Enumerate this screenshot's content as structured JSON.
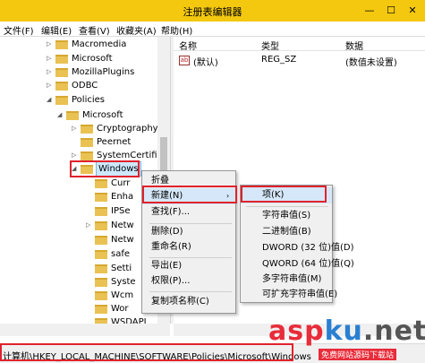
{
  "window": {
    "title": "注册表编辑器",
    "min": "—",
    "max": "☐",
    "close": "✕"
  },
  "menubar": [
    "文件(F)",
    "编辑(E)",
    "查看(V)",
    "收藏夹(A)",
    "帮助(H)"
  ],
  "tree": [
    {
      "label": "Macromedia",
      "arrow": "▷"
    },
    {
      "label": "Microsoft",
      "arrow": "▷"
    },
    {
      "label": "MozillaPlugins",
      "arrow": "▷"
    },
    {
      "label": "ODBC",
      "arrow": "▷"
    },
    {
      "label": "Policies",
      "arrow": "◢"
    },
    {
      "label": "Microsoft",
      "arrow": "◢"
    },
    {
      "label": "Cryptography",
      "arrow": "▷"
    },
    {
      "label": "Peernet",
      "arrow": ""
    },
    {
      "label": "SystemCertifica",
      "arrow": "▷"
    },
    {
      "label": "Windows",
      "arrow": "◢"
    },
    {
      "label": "Curr",
      "arrow": ""
    },
    {
      "label": "Enha",
      "arrow": ""
    },
    {
      "label": "IPSe",
      "arrow": ""
    },
    {
      "label": "Netw",
      "arrow": "▷"
    },
    {
      "label": "Netw",
      "arrow": ""
    },
    {
      "label": "safe",
      "arrow": ""
    },
    {
      "label": "Setti",
      "arrow": ""
    },
    {
      "label": "Syste",
      "arrow": ""
    },
    {
      "label": "Wcm",
      "arrow": ""
    },
    {
      "label": "Wor",
      "arrow": ""
    },
    {
      "label": "WSDAPI",
      "arrow": ""
    }
  ],
  "list": {
    "headers": {
      "name": "名称",
      "type": "类型",
      "data": "数据"
    },
    "rows": [
      {
        "icon": "ab",
        "name": "(默认)",
        "type": "REG_SZ",
        "data": "(数值未设置)"
      }
    ]
  },
  "context_menu": [
    "折叠",
    "新建(N)",
    "查找(F)...",
    "删除(D)",
    "重命名(R)",
    "导出(E)",
    "权限(P)...",
    "复制项名称(C)"
  ],
  "sub_arrow": "›",
  "submenu": [
    "项(K)",
    "字符串值(S)",
    "二进制值(B)",
    "DWORD (32 位)值(D)",
    "QWORD (64 位)值(Q)",
    "多字符串值(M)",
    "可扩充字符串值(E)"
  ],
  "status": "计算机\\HKEY_LOCAL_MACHINE\\SOFTWARE\\Policies\\Microsoft\\Windows",
  "watermark": {
    "a": "asp",
    "k": "ku",
    "d": ".net",
    "sub": "免费网站源码下载站"
  }
}
